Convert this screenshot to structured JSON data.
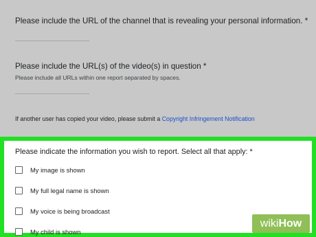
{
  "form": {
    "q_channel_url": "Please include the URL of the channel that is revealing your personal information. *",
    "q_video_urls": "Please include the URL(s) of the video(s) in question *",
    "q_video_urls_help": "Please include all URLs within one report separated by spaces.",
    "copyright_note": "If another user has copied your video, please submit a",
    "copyright_link": "Copyright Infringement Notification",
    "info_question": "Please indicate the information you wish to report. Select all that apply: *",
    "options": [
      {
        "label": "My image is shown",
        "checked": false
      },
      {
        "label": "My full legal name is shown",
        "checked": false
      },
      {
        "label": "My voice is being broadcast",
        "checked": false
      },
      {
        "label": "My child is shown",
        "checked": false
      }
    ]
  },
  "watermark": {
    "part1": "wiki",
    "part2": "How"
  },
  "colors": {
    "highlight": "#22e023",
    "link": "#1a4fc9",
    "watermark_bg": "#8fbf56"
  }
}
